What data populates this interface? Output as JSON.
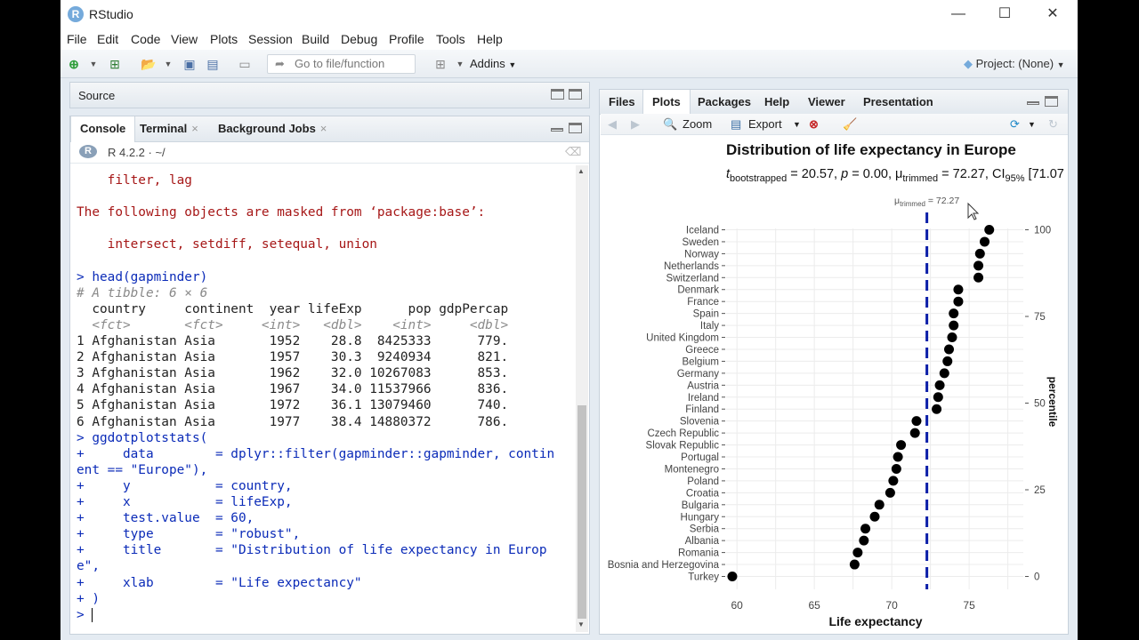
{
  "app": {
    "title": "RStudio",
    "logo_letter": "R"
  },
  "window_controls": {
    "minimize": "—",
    "maximize": "☐",
    "close": "✕"
  },
  "menu": [
    "File",
    "Edit",
    "Code",
    "View",
    "Plots",
    "Session",
    "Build",
    "Debug",
    "Profile",
    "Tools",
    "Help"
  ],
  "toolbar": {
    "goto_placeholder": "Go to file/function",
    "addins": "Addins",
    "project": "Project: (None)"
  },
  "source_pane": {
    "title": "Source"
  },
  "console_pane": {
    "tabs": [
      "Console",
      "Terminal",
      "Background Jobs"
    ],
    "r_version": "R 4.2.2 · ~/",
    "lines": [
      {
        "t": "    filter, lag",
        "c": "red"
      },
      {
        "t": "",
        "c": ""
      },
      {
        "t": "The following objects are masked from ‘package:base’:",
        "c": "red"
      },
      {
        "t": "",
        "c": ""
      },
      {
        "t": "    intersect, setdiff, setequal, union",
        "c": "red"
      },
      {
        "t": "",
        "c": ""
      },
      {
        "t": "> head(gapminder)",
        "c": "blue"
      },
      {
        "t": "# A tibble: 6 × 6",
        "c": "gray"
      },
      {
        "t": "  country     continent  year lifeExp      pop gdpPercap",
        "c": ""
      },
      {
        "t": "  <fct>       <fct>     <int>   <dbl>    <int>     <dbl>",
        "c": "gray"
      },
      {
        "t": "1 Afghanistan Asia       1952    28.8  8425333      779.",
        "c": ""
      },
      {
        "t": "2 Afghanistan Asia       1957    30.3  9240934      821.",
        "c": ""
      },
      {
        "t": "3 Afghanistan Asia       1962    32.0 10267083      853.",
        "c": ""
      },
      {
        "t": "4 Afghanistan Asia       1967    34.0 11537966      836.",
        "c": ""
      },
      {
        "t": "5 Afghanistan Asia       1972    36.1 13079460      740.",
        "c": ""
      },
      {
        "t": "6 Afghanistan Asia       1977    38.4 14880372      786.",
        "c": ""
      },
      {
        "t": "> ggdotplotstats(",
        "c": "blue"
      },
      {
        "t": "+     data        = dplyr::filter(gapminder::gapminder, contin",
        "c": "blue"
      },
      {
        "t": "ent == \"Europe\"),",
        "c": "blue"
      },
      {
        "t": "+     y           = country,",
        "c": "blue"
      },
      {
        "t": "+     x           = lifeExp,",
        "c": "blue"
      },
      {
        "t": "+     test.value  = 60,",
        "c": "blue"
      },
      {
        "t": "+     type        = \"robust\",",
        "c": "blue"
      },
      {
        "t": "+     title       = \"Distribution of life expectancy in Europ",
        "c": "blue"
      },
      {
        "t": "e\",",
        "c": "blue"
      },
      {
        "t": "+     xlab        = \"Life expectancy\"",
        "c": "blue"
      },
      {
        "t": "+ )",
        "c": "blue"
      },
      {
        "t": ">",
        "c": "blue"
      }
    ]
  },
  "right_pane": {
    "tabs": [
      "Files",
      "Plots",
      "Packages",
      "Help",
      "Viewer",
      "Presentation"
    ],
    "zoom_label": "Zoom",
    "export_label": "Export"
  },
  "chart_data": {
    "type": "scatter",
    "title": "Distribution of life expectancy in Europe",
    "subtitle": "t_bootstrapped = 20.57, p = 0.00, μ̂_trimmed = 72.27, CI_95% [71.07",
    "subtitle_parts": {
      "t": "t",
      "t_sub": "bootstrapped",
      "t_val": " = 20.57, ",
      "p": "p",
      "p_val": " = 0.00, ",
      "mu": "μ",
      "mu_sub": "trimmed",
      "mu_val": " = 72.27, CI",
      "ci_sub": "95%",
      "ci_val": " [71.07"
    },
    "reference_label": "μ̂trimmed = 72.27",
    "reference_label_parts": {
      "mu": "μ",
      "mu_sub": "trimmed",
      "mu_val": " = 72.27"
    },
    "reference_value": 72.27,
    "xlabel": "Life expectancy",
    "ylabel_right": "percentile",
    "xlim": [
      59.3,
      78.5
    ],
    "xticks": [
      60,
      65,
      70,
      75
    ],
    "right_ticks": [
      0,
      25,
      50,
      75,
      100
    ],
    "colors": {
      "points": "#000000",
      "reference_line": "#0b1ea8"
    },
    "categories": [
      "Turkey",
      "Bosnia and Herzegovina",
      "Romania",
      "Albania",
      "Serbia",
      "Hungary",
      "Bulgaria",
      "Croatia",
      "Poland",
      "Montenegro",
      "Portugal",
      "Slovak Republic",
      "Czech Republic",
      "Slovenia",
      "Finland",
      "Ireland",
      "Austria",
      "Germany",
      "Belgium",
      "Greece",
      "United Kingdom",
      "Italy",
      "Spain",
      "France",
      "Denmark",
      "Switzerland",
      "Netherlands",
      "Norway",
      "Sweden",
      "Iceland"
    ],
    "values": [
      59.7,
      67.6,
      67.8,
      68.2,
      68.3,
      68.9,
      69.2,
      69.9,
      70.1,
      70.3,
      70.4,
      70.6,
      71.5,
      71.6,
      72.9,
      73.0,
      73.1,
      73.4,
      73.6,
      73.7,
      73.9,
      74.0,
      74.0,
      74.3,
      74.3,
      75.6,
      75.6,
      75.7,
      76.0,
      76.3
    ]
  }
}
